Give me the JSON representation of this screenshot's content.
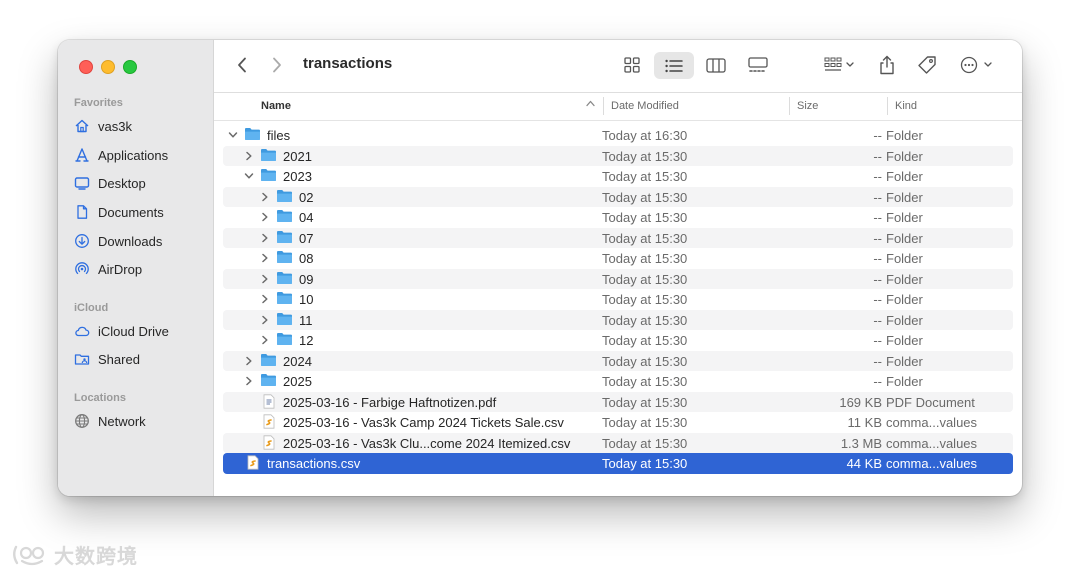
{
  "sidebar": {
    "favorites_title": "Favorites",
    "favorites": [
      {
        "label": "vas3k",
        "icon": "home-icon"
      },
      {
        "label": "Applications",
        "icon": "applications-icon"
      },
      {
        "label": "Desktop",
        "icon": "desktop-icon"
      },
      {
        "label": "Documents",
        "icon": "document-icon"
      },
      {
        "label": "Downloads",
        "icon": "download-icon"
      },
      {
        "label": "AirDrop",
        "icon": "airdrop-icon"
      }
    ],
    "icloud_title": "iCloud",
    "icloud": [
      {
        "label": "iCloud Drive",
        "icon": "cloud-icon"
      },
      {
        "label": "Shared",
        "icon": "shared-folder-icon"
      }
    ],
    "locations_title": "Locations",
    "locations": [
      {
        "label": "Network",
        "icon": "network-icon"
      }
    ]
  },
  "toolbar": {
    "title": "transactions",
    "view_mode": "list"
  },
  "columns": {
    "name": "Name",
    "date": "Date Modified",
    "size": "Size",
    "kind": "Kind"
  },
  "rows": [
    {
      "name": "files",
      "date": "Today at 16:30",
      "size": "--",
      "kind": "Folder",
      "type": "folder",
      "depth": 0,
      "expanded": true
    },
    {
      "name": "2021",
      "date": "Today at 15:30",
      "size": "--",
      "kind": "Folder",
      "type": "folder",
      "depth": 1,
      "expanded": false
    },
    {
      "name": "2023",
      "date": "Today at 15:30",
      "size": "--",
      "kind": "Folder",
      "type": "folder",
      "depth": 1,
      "expanded": true
    },
    {
      "name": "02",
      "date": "Today at 15:30",
      "size": "--",
      "kind": "Folder",
      "type": "folder",
      "depth": 2,
      "expanded": false
    },
    {
      "name": "04",
      "date": "Today at 15:30",
      "size": "--",
      "kind": "Folder",
      "type": "folder",
      "depth": 2,
      "expanded": false
    },
    {
      "name": "07",
      "date": "Today at 15:30",
      "size": "--",
      "kind": "Folder",
      "type": "folder",
      "depth": 2,
      "expanded": false
    },
    {
      "name": "08",
      "date": "Today at 15:30",
      "size": "--",
      "kind": "Folder",
      "type": "folder",
      "depth": 2,
      "expanded": false
    },
    {
      "name": "09",
      "date": "Today at 15:30",
      "size": "--",
      "kind": "Folder",
      "type": "folder",
      "depth": 2,
      "expanded": false
    },
    {
      "name": "10",
      "date": "Today at 15:30",
      "size": "--",
      "kind": "Folder",
      "type": "folder",
      "depth": 2,
      "expanded": false
    },
    {
      "name": "11",
      "date": "Today at 15:30",
      "size": "--",
      "kind": "Folder",
      "type": "folder",
      "depth": 2,
      "expanded": false
    },
    {
      "name": "12",
      "date": "Today at 15:30",
      "size": "--",
      "kind": "Folder",
      "type": "folder",
      "depth": 2,
      "expanded": false
    },
    {
      "name": "2024",
      "date": "Today at 15:30",
      "size": "--",
      "kind": "Folder",
      "type": "folder",
      "depth": 1,
      "expanded": false
    },
    {
      "name": "2025",
      "date": "Today at 15:30",
      "size": "--",
      "kind": "Folder",
      "type": "folder",
      "depth": 1,
      "expanded": false
    },
    {
      "name": "2025-03-16 - Farbige Haftnotizen.pdf",
      "date": "Today at 15:30",
      "size": "169 KB",
      "kind": "PDF Document",
      "type": "pdf",
      "depth": 1
    },
    {
      "name": "2025-03-16 - Vas3k Camp 2024 Tickets Sale.csv",
      "date": "Today at 15:30",
      "size": "11 KB",
      "kind": "comma...values",
      "type": "csv",
      "depth": 1
    },
    {
      "name": "2025-03-16 - Vas3k Clu...come 2024 Itemized.csv",
      "date": "Today at 15:30",
      "size": "1.3 MB",
      "kind": "comma...values",
      "type": "csv",
      "depth": 1
    },
    {
      "name": "transactions.csv",
      "date": "Today at 15:30",
      "size": "44 KB",
      "kind": "comma...values",
      "type": "csv",
      "depth": 0,
      "selected": true
    }
  ],
  "watermark": "大数跨境",
  "colors": {
    "selection": "#2f64d4",
    "folder": "#5fb3f0",
    "accent_icon": "#2f6fe0"
  }
}
